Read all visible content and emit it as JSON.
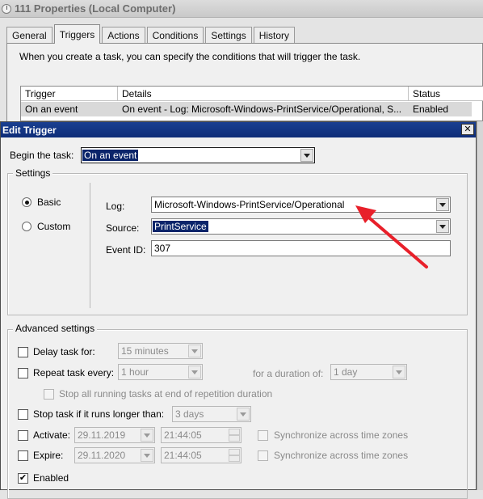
{
  "bg_window": {
    "title": "111 Properties (Local Computer)",
    "tabs": [
      "General",
      "Triggers",
      "Actions",
      "Conditions",
      "Settings",
      "History"
    ],
    "active_tab": "Triggers",
    "intro": "When you create a task, you can specify the conditions that will trigger the task.",
    "table": {
      "columns": [
        "Trigger",
        "Details",
        "Status"
      ],
      "rows": [
        {
          "trigger": "On an event",
          "details": "On event - Log: Microsoft-Windows-PrintService/Operational, S...",
          "status": "Enabled"
        }
      ]
    }
  },
  "dialog": {
    "title": "Edit Trigger",
    "close_symbol": "✕",
    "begin_label": "Begin the task:",
    "begin_value": "On an event",
    "settings": {
      "legend": "Settings",
      "radio_basic": "Basic",
      "radio_custom": "Custom",
      "selected_mode": "Basic",
      "log_label": "Log:",
      "log_value": "Microsoft-Windows-PrintService/Operational",
      "source_label": "Source:",
      "source_value": "PrintService",
      "event_id_label": "Event ID:",
      "event_id_value": "307"
    },
    "advanced": {
      "legend": "Advanced settings",
      "delay_label": "Delay task for:",
      "delay_value": "15 minutes",
      "delay_checked": false,
      "repeat_label": "Repeat task every:",
      "repeat_value": "1 hour",
      "repeat_checked": false,
      "duration_label": "for a duration of:",
      "duration_value": "1 day",
      "stop_all_label": "Stop all running tasks at end of repetition duration",
      "stop_if_label": "Stop task if it runs longer than:",
      "stop_if_value": "3 days",
      "stop_if_checked": false,
      "activate_label": "Activate:",
      "activate_date": "29.11.2019",
      "activate_time": "21:44:05",
      "activate_checked": false,
      "expire_label": "Expire:",
      "expire_date": "29.11.2020",
      "expire_time": "21:44:05",
      "expire_checked": false,
      "sync_label": "Synchronize across time zones",
      "enabled_label": "Enabled",
      "enabled_checked": true
    }
  },
  "colors": {
    "title_bar": "#1a3f91",
    "selection": "#0a246a",
    "annotation_arrow": "#e8202a"
  },
  "check_mark": "✔"
}
